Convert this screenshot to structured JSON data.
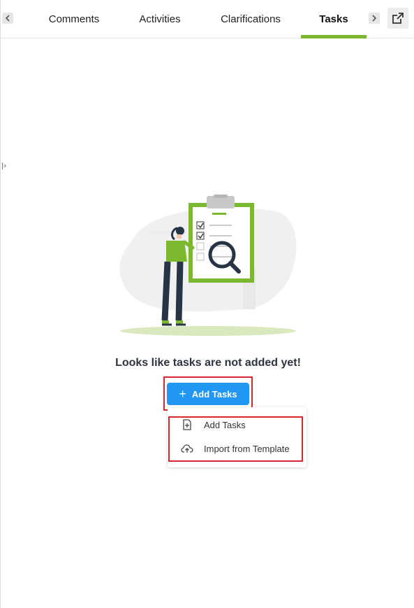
{
  "colors": {
    "accent": "#7cb82f",
    "primary_button": "#2196f3",
    "highlight_box": "#d8262f"
  },
  "tabs": [
    {
      "label": "Comments",
      "active": false
    },
    {
      "label": "Activities",
      "active": false
    },
    {
      "label": "Clarifications",
      "active": false
    },
    {
      "label": "Tasks",
      "active": true
    }
  ],
  "icons": {
    "scroll_left": "chevron-left-icon",
    "scroll_right": "chevron-right-icon",
    "popout": "external-link-icon",
    "illustration": "empty-tasks-illustration",
    "add": "plus-icon",
    "menu_add": "file-plus-icon",
    "menu_import": "cloud-upload-icon"
  },
  "empty_state": {
    "message": "Looks like tasks are not added yet!",
    "add_button_label": "Add Tasks"
  },
  "menu": {
    "items": [
      {
        "label": "Add Tasks"
      },
      {
        "label": "Import from Template"
      }
    ]
  }
}
